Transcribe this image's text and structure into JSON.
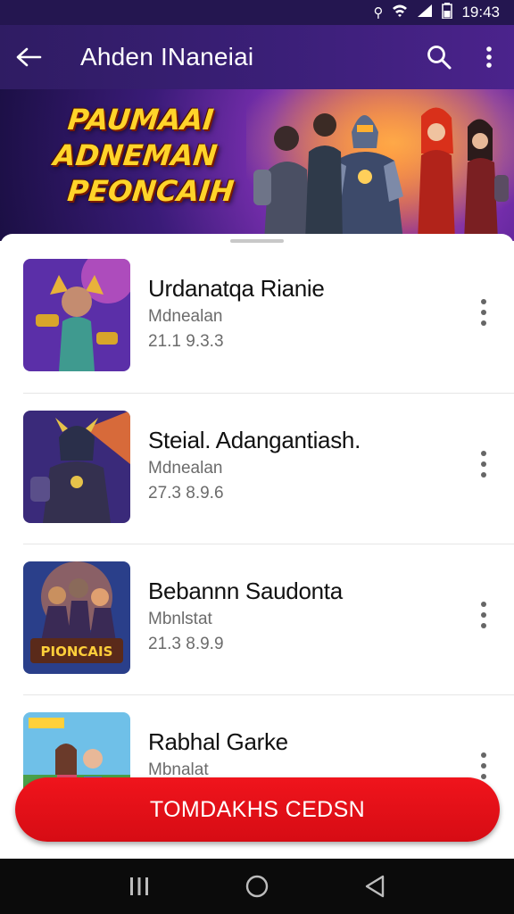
{
  "status_bar": {
    "time": "19:43"
  },
  "app_bar": {
    "title": "Ahden INaneiai"
  },
  "hero": {
    "title_lines": [
      "PAUMAAI",
      "ADNEMAN",
      "PEONCAIH"
    ]
  },
  "items": [
    {
      "title": "Urdanatqa Rianie",
      "subtitle": "Mdnealan",
      "meta": "21.1 9.3.3"
    },
    {
      "title": "Steial. Adangantiash.",
      "subtitle": "Mdnealan",
      "meta": "27.3 8.9.6"
    },
    {
      "title": "Bebannn Saudonta",
      "subtitle": "Mbnlstat",
      "meta": "21.3 8.9.9"
    },
    {
      "title": "Rabhal Garke",
      "subtitle": "Mbnalat",
      "meta": ""
    }
  ],
  "cta": {
    "label": "TOMDAKHS CEDSN"
  },
  "colors": {
    "accent": "#3b1f78",
    "cta": "#e0101a"
  }
}
